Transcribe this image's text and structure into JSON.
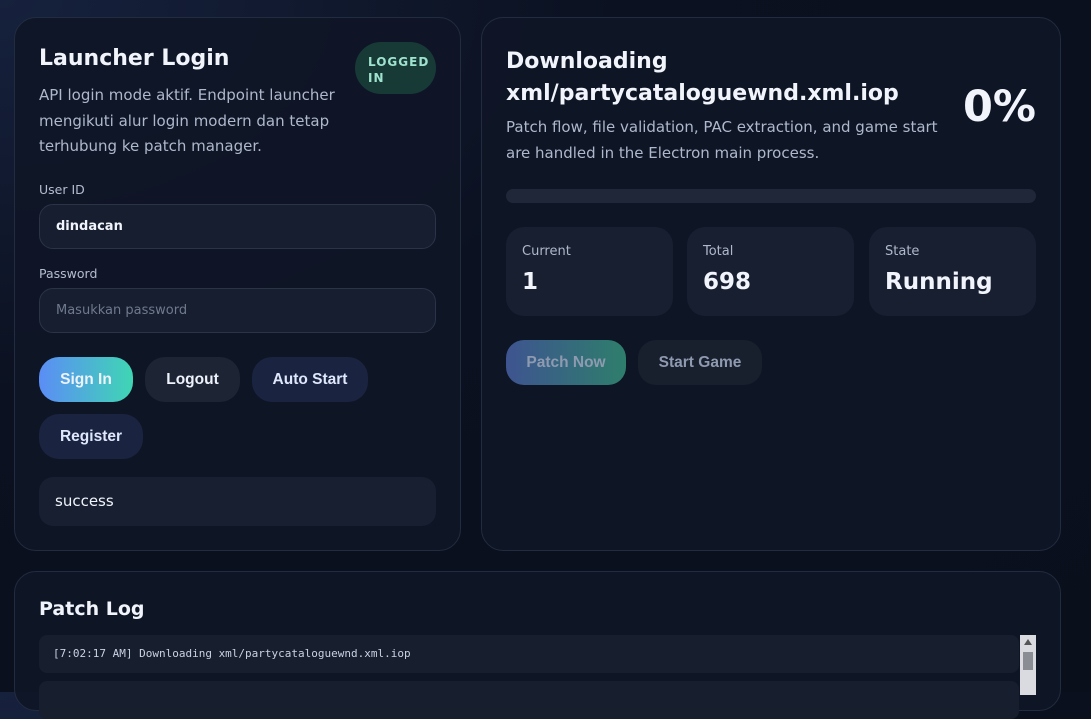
{
  "login": {
    "title": "Launcher Login",
    "badge": "LOGGED IN",
    "description": "API login mode aktif. Endpoint launcher mengikuti alur login modern dan tetap terhubung ke patch manager.",
    "userid_label": "User ID",
    "userid_value": "dindacan",
    "password_label": "Password",
    "password_placeholder": "Masukkan password",
    "buttons": {
      "sign_in": "Sign In",
      "logout": "Logout",
      "auto_start": "Auto Start",
      "register": "Register"
    },
    "status": "success"
  },
  "patch": {
    "title": "Downloading xml/partycataloguewnd.xml.iop",
    "percent": "0%",
    "progress": 0,
    "description": "Patch flow, file validation, PAC extraction, and game start are handled in the Electron main process.",
    "stats": [
      {
        "label": "Current",
        "value": "1"
      },
      {
        "label": "Total",
        "value": "698"
      },
      {
        "label": "State",
        "value": "Running"
      }
    ],
    "buttons": {
      "patch_now": "Patch Now",
      "start_game": "Start Game"
    }
  },
  "log": {
    "title": "Patch Log",
    "lines": [
      "[7:02:17 AM] Downloading xml/partycataloguewnd.xml.iop",
      ""
    ]
  }
}
